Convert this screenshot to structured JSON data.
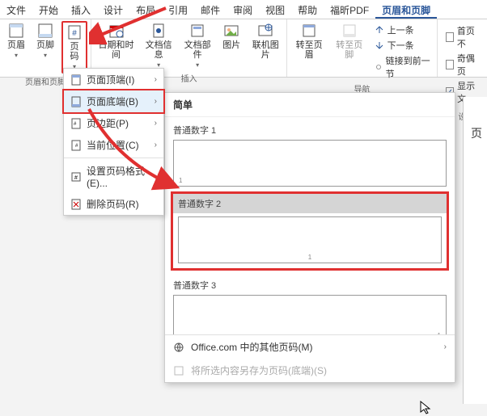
{
  "tabs": [
    "文件",
    "开始",
    "插入",
    "设计",
    "布局",
    "引用",
    "邮件",
    "审阅",
    "视图",
    "帮助",
    "福昕PDF",
    "页眉和页脚"
  ],
  "active_tab": 11,
  "ribbon": {
    "group_hf": {
      "label": "页眉和页脚",
      "header": "页眉",
      "footer": "页脚",
      "pagenum": "页码"
    },
    "group_insert": {
      "label": "插入",
      "datetime": "日期和时间",
      "docinfo": "文档信息",
      "docparts": "文档部件",
      "image": "图片",
      "online": "联机图片"
    },
    "group_nav": {
      "label": "导航",
      "goto_header": "转至页眉",
      "goto_footer": "转至页脚",
      "prev": "上一条",
      "next": "下一条",
      "link_prev": "链接到前一节"
    },
    "group_opts": {
      "first_diff": "首页不",
      "odd_even": "奇偶页",
      "show_text": "显示文"
    }
  },
  "dropdown": {
    "top": "页面顶端(I)",
    "bottom": "页面底端(B)",
    "margins": "页边距(P)",
    "current": "当前位置(C)",
    "format": "设置页码格式(E)...",
    "remove": "删除页码(R)"
  },
  "gallery": {
    "header": "简单",
    "item1": "普通数字 1",
    "item2": "普通数字 2",
    "item3": "普通数字 3",
    "more_office": "Office.com 中的其他页码(M)",
    "save_sel": "将所选内容另存为页码(底端)(S)"
  },
  "page_char": "页"
}
